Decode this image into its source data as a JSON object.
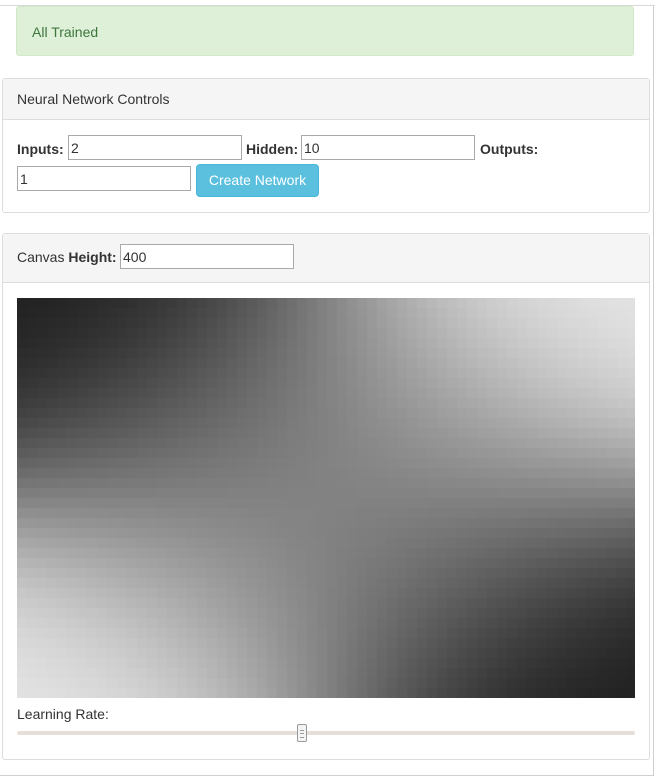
{
  "status": {
    "message": "All Trained",
    "color": "#3c763d",
    "background": "#dff0d8"
  },
  "controls": {
    "heading": "Neural Network Controls",
    "inputs_label": "Inputs:",
    "inputs_value": "2",
    "hidden_label": "Hidden:",
    "hidden_value": "10",
    "outputs_label": "Outputs:",
    "outputs_value": "1",
    "create_button": "Create Network",
    "button_color": "#5bc0de"
  },
  "canvas_panel": {
    "height_label_prefix": "Canvas",
    "height_label_bold": "Height:",
    "height_value": "400",
    "learning_rate_label": "Learning Rate:",
    "learning_rate_level": 0.46
  }
}
